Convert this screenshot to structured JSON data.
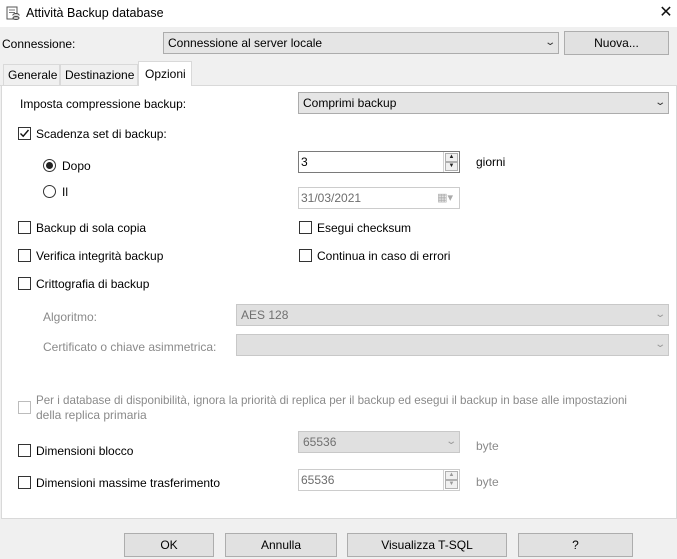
{
  "window": {
    "title": "Attività Backup database",
    "close_glyph": "✕"
  },
  "connection": {
    "label": "Connessione:",
    "selected": "Connessione al server locale",
    "new_button": "Nuova..."
  },
  "tabs": [
    {
      "label": "Generale",
      "active": false
    },
    {
      "label": "Destinazione",
      "active": false
    },
    {
      "label": "Opzioni",
      "active": true
    }
  ],
  "options": {
    "compression": {
      "label": "Imposta compressione backup:",
      "selected": "Comprimi backup"
    },
    "expiration": {
      "label": "Scadenza set di backup:",
      "checked": true,
      "after_label": "Dopo",
      "after_selected": true,
      "after_value": "3",
      "after_unit": "giorni",
      "on_label": "Il",
      "on_selected": false,
      "on_date": "31/03/2021"
    },
    "copy_only": {
      "label": "Backup di sola copia",
      "checked": false
    },
    "checksum": {
      "label": "Esegui checksum",
      "checked": false
    },
    "verify": {
      "label": "Verifica integrità backup",
      "checked": false
    },
    "continue_on_error": {
      "label": "Continua in caso di errori",
      "checked": false
    },
    "encryption": {
      "label": "Crittografia di backup",
      "checked": false
    },
    "algorithm": {
      "label": "Algoritmo:",
      "selected": "AES 128"
    },
    "certificate": {
      "label": "Certificato o chiave asimmetrica:",
      "selected": ""
    },
    "availability": {
      "label_line1": "Per i database di disponibilità, ignora la priorità di replica per il backup ed esegui il backup in base alle impostazioni",
      "label_line2": "della replica primaria",
      "checked": false
    },
    "block_size": {
      "label": "Dimensioni blocco",
      "value": "65536",
      "unit": "byte",
      "checked": false
    },
    "max_transfer": {
      "label": "Dimensioni massime trasferimento",
      "value": "65536",
      "unit": "byte",
      "checked": false
    }
  },
  "footer": {
    "ok": "OK",
    "cancel": "Annulla",
    "script": "Visualizza T-SQL",
    "help": "?"
  }
}
